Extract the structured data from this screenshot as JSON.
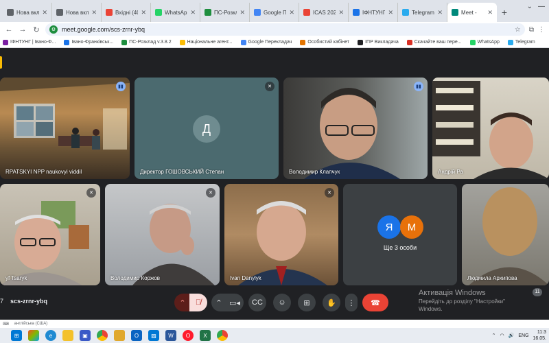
{
  "browser": {
    "tabs": [
      {
        "title": "Нова вкла",
        "favicon": "#5f6368",
        "icon": "globe"
      },
      {
        "title": "Нова вкла",
        "favicon": "#5f6368",
        "icon": "globe"
      },
      {
        "title": "Вхідні (40)",
        "favicon": "#ea4335",
        "icon": "mail"
      },
      {
        "title": "WhatsApp",
        "favicon": "#25d366",
        "icon": "whatsapp"
      },
      {
        "title": "ПС-Розкл",
        "favicon": "#1e8e3e",
        "icon": "schedule"
      },
      {
        "title": "Google Пе",
        "favicon": "#4285f4",
        "icon": "translate"
      },
      {
        "title": "ICAS 2025",
        "favicon": "#ea4335",
        "icon": "mail"
      },
      {
        "title": "ІФНТУНГ -",
        "favicon": "#1a73e8",
        "icon": "doc"
      },
      {
        "title": "Telegram",
        "favicon": "#2aabee",
        "icon": "telegram"
      },
      {
        "title": "Meet -",
        "favicon": "#00897b",
        "icon": "meet",
        "active": true
      }
    ],
    "url": "meet.google.com/scs-zrnr-ybq",
    "bookmarks": [
      {
        "label": "ІФНТУНГ | Івано-Ф...",
        "color": "#7b1fa2"
      },
      {
        "label": "Івано-Франківськ...",
        "color": "#1a73e8"
      },
      {
        "label": "ПС-Розклад v.3.8.2",
        "color": "#1e8e3e"
      },
      {
        "label": "Національне агент...",
        "color": "#fbbc04"
      },
      {
        "label": "Google Перекладач",
        "color": "#4285f4"
      },
      {
        "label": "Особистий кабінет",
        "color": "#e37400"
      },
      {
        "label": "ІПР Викладача",
        "color": "#202124"
      },
      {
        "label": "Скачайте ваш пере...",
        "color": "#d93025"
      },
      {
        "label": "WhatsApp",
        "color": "#25d366"
      },
      {
        "label": "Telegram",
        "color": "#2aabee"
      }
    ]
  },
  "meet": {
    "code": "scs-zrnr-ybq",
    "time_fragment": "7",
    "participants": [
      {
        "name": "RPATSKYI NPP naukovyi viddil",
        "mic": "speaking"
      },
      {
        "name": "Директор ГОШОВСЬКИЙ Степан",
        "mic": "muted",
        "initial": "Д"
      },
      {
        "name": "Володимир Клапчук",
        "mic": "speaking"
      },
      {
        "name": "Андрій Ра",
        "mic": "none"
      },
      {
        "name": "yf Tsaryk",
        "mic": "muted"
      },
      {
        "name": "Володимир Коржов",
        "mic": "muted"
      },
      {
        "name": "Ivan Danylyk",
        "mic": "muted"
      },
      {
        "name": "Ще 3 особи",
        "avatars": [
          "Я",
          "М"
        ]
      },
      {
        "name": "Людмила Архипова",
        "mic": "none"
      }
    ],
    "participant_count": "11"
  },
  "activation": {
    "title": "Активація Windows",
    "line1": "Перейдіть до розділу \"Настройки\"",
    "line2": "Windows."
  },
  "statusbar": {
    "lang_hint": "англійська (США)"
  },
  "taskbar": {
    "lang": "ENG",
    "time": "11:3",
    "date": "16.05."
  }
}
